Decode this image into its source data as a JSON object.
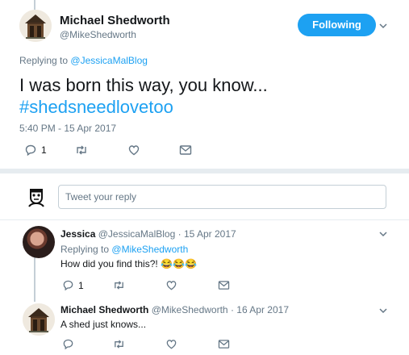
{
  "main_tweet": {
    "name": "Michael Shedworth",
    "handle": "@MikeShedworth",
    "follow_label": "Following",
    "replying_to_label": "Replying to",
    "replying_to_handle": "@JessicaMalBlog",
    "text": "I was born this way, you know...",
    "hashtag": "#shedsneedlovetoo",
    "timestamp": "5:40 PM - 15 Apr 2017",
    "reply_count": "1",
    "retweet_count": "",
    "like_count": ""
  },
  "reply_box": {
    "placeholder": "Tweet your reply"
  },
  "replies": [
    {
      "name": "Jessica",
      "handle": "@JessicaMalBlog",
      "date": "15 Apr 2017",
      "replying_to_label": "Replying to",
      "replying_to_handle": "@MikeShedworth",
      "text": "How did you find this?!",
      "emoji": "😂😂😂",
      "reply_count": "1"
    },
    {
      "name": "Michael Shedworth",
      "handle": "@MikeShedworth",
      "date": "16 Apr 2017",
      "text": "A shed just knows...",
      "reply_count": ""
    }
  ],
  "separator": "·",
  "colors": {
    "accent": "#1da1f2",
    "muted": "#657786",
    "divider": "#e6ecf0"
  }
}
